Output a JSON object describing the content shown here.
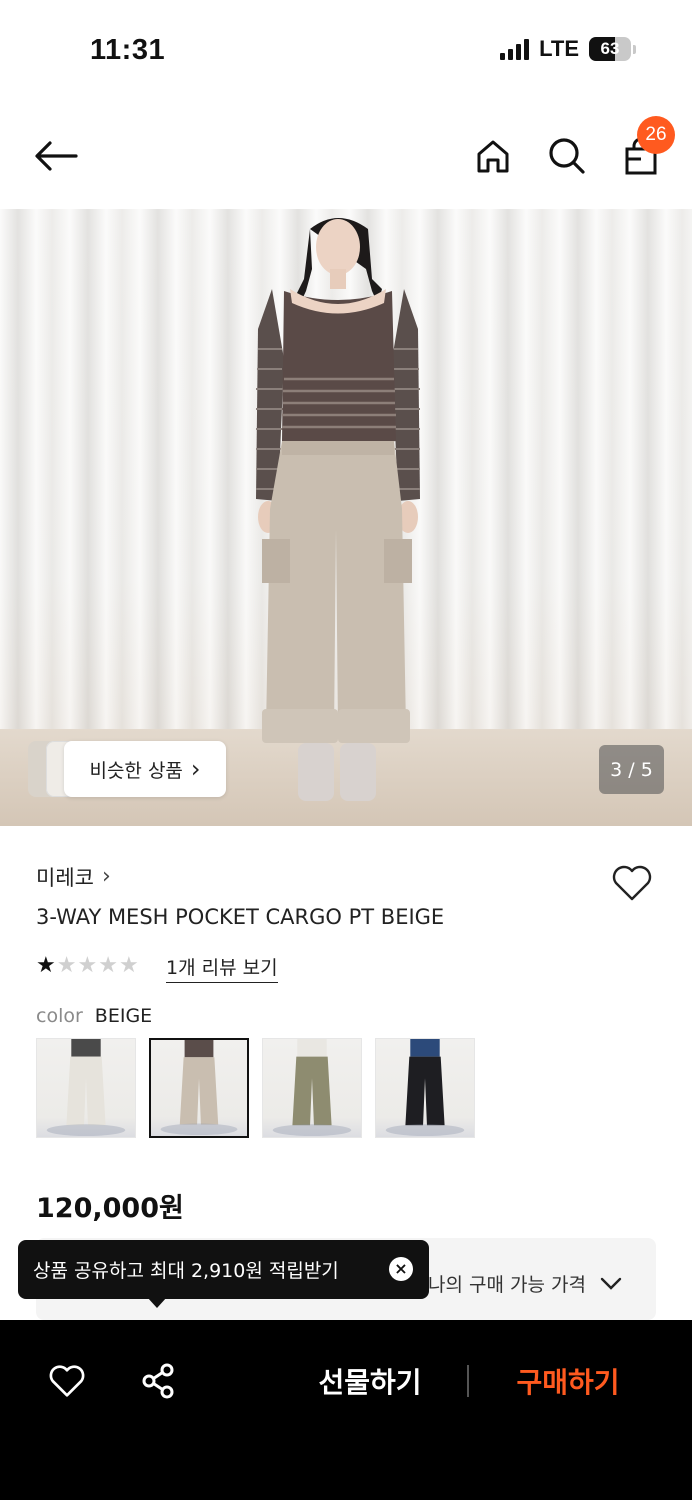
{
  "status_bar": {
    "time": "11:31",
    "network": "LTE",
    "battery": "63",
    "battery_level": 0.63
  },
  "nav": {
    "cart_count": "26",
    "icons": [
      "back-arrow-icon",
      "home-icon",
      "search-icon",
      "cart-icon"
    ]
  },
  "gallery": {
    "counter": "3 / 5",
    "similar_label": "비슷한 상품",
    "similar_chevron": "›"
  },
  "product": {
    "brand": "미레코",
    "brand_chevron": "›",
    "name": "3-WAY MESH POCKET CARGO PT BEIGE",
    "rating": 1,
    "rating_max": 5,
    "review_link": "1개 리뷰 보기",
    "option_label": "color",
    "option_value": "BEIGE",
    "swatches": [
      {
        "color_name": "white",
        "pants": "#e6e3dc",
        "top": "#4a4a4a",
        "selected": false
      },
      {
        "color_name": "beige",
        "pants": "#c9beb0",
        "top": "#5a4d4a",
        "selected": true
      },
      {
        "color_name": "khaki",
        "pants": "#8e8c70",
        "top": "#e9e7e2",
        "selected": false
      },
      {
        "color_name": "black",
        "pants": "#1e1e22",
        "top": "#2c4a7a",
        "selected": false
      }
    ],
    "price": "120,000원",
    "my_price_label": "나의 구매 가능 가격"
  },
  "tooltip": {
    "text": "상품 공유하고 최대 2,910원 적립받기",
    "close": "×"
  },
  "bottom_bar": {
    "gift_label": "선물하기",
    "buy_label": "구매하기"
  },
  "colors": {
    "accent": "#ff5a1f",
    "text": "#111111",
    "muted": "#8a8a8a"
  }
}
